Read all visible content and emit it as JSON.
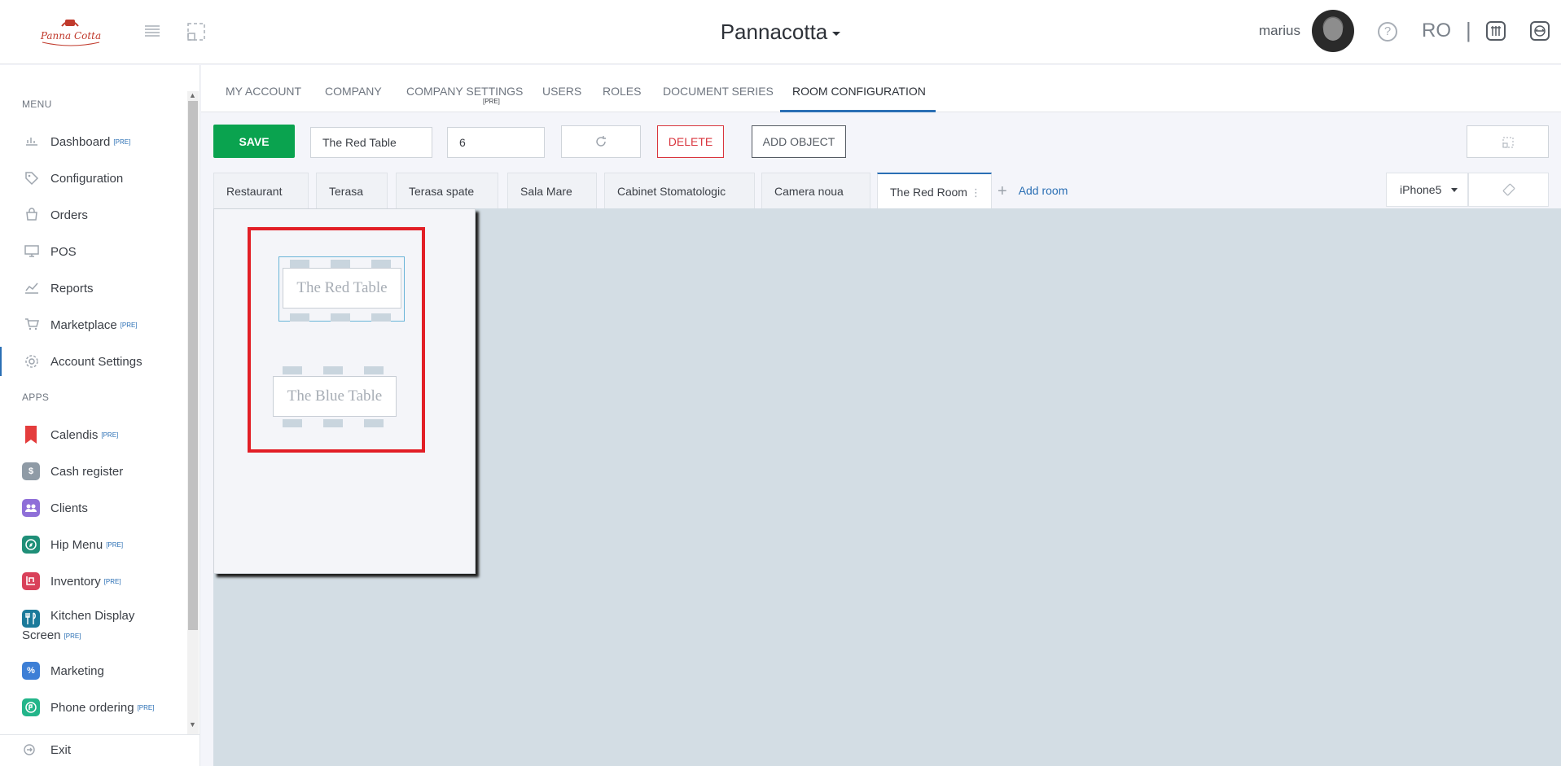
{
  "header": {
    "app_title": "Pannacotta",
    "user_name": "marius",
    "language": "RO",
    "separator": "|",
    "help_symbol": "?",
    "icons": [
      "menu-icon",
      "expand-icon",
      "help-icon",
      "grid-icon",
      "exit-fullscreen-icon"
    ]
  },
  "sidebar": {
    "menu_label": "MENU",
    "apps_label": "APPS",
    "pre_tag": "[PRE]",
    "menu_items": [
      {
        "label": "Dashboard",
        "pre": true,
        "icon": "chart-icon"
      },
      {
        "label": "Configuration",
        "pre": false,
        "icon": "tag-icon"
      },
      {
        "label": "Orders",
        "pre": false,
        "icon": "bag-icon"
      },
      {
        "label": "POS",
        "pre": false,
        "icon": "monitor-icon"
      },
      {
        "label": "Reports",
        "pre": false,
        "icon": "reports-icon"
      },
      {
        "label": "Marketplace",
        "pre": true,
        "icon": "cart-icon"
      },
      {
        "label": "Account Settings",
        "pre": false,
        "icon": "gear-icon"
      }
    ],
    "apps": [
      {
        "label": "Calendis",
        "pre": true,
        "color": "#e43c3c",
        "icon": "bookmark-icon"
      },
      {
        "label": "Cash register",
        "pre": false,
        "color": "#8f9ba6",
        "icon": "cash-register-icon"
      },
      {
        "label": "Clients",
        "pre": false,
        "color": "#8f6fd8",
        "icon": "clients-icon"
      },
      {
        "label": "Hip Menu",
        "pre": true,
        "color": "#1f8f78",
        "icon": "compass-icon"
      },
      {
        "label": "Inventory",
        "pre": true,
        "color": "#d9415a",
        "icon": "inventory-icon"
      },
      {
        "label": "Kitchen Display",
        "label2": "Screen",
        "pre": true,
        "color": "#1b7a9a",
        "icon": "utensils-icon"
      },
      {
        "label": "Marketing",
        "pre": false,
        "color": "#3d7fd6",
        "icon": "marketing-icon"
      },
      {
        "label": "Phone ordering",
        "pre": true,
        "color": "#23b58a",
        "icon": "phone-icon"
      }
    ],
    "exit_label": "Exit"
  },
  "top_tabs": {
    "items": [
      "MY ACCOUNT",
      "COMPANY",
      "COMPANY SETTINGS",
      "USERS",
      "ROLES",
      "DOCUMENT SERIES",
      "ROOM CONFIGURATION"
    ],
    "active": "ROOM CONFIGURATION",
    "pre_tag": "[PRE]"
  },
  "toolbar": {
    "save_label": "SAVE",
    "table_name": "The Red Table",
    "seats": "6",
    "delete_label": "DELETE",
    "add_object_label": "ADD OBJECT"
  },
  "rooms": {
    "tabs": [
      "Restaurant",
      "Terasa",
      "Terasa spate",
      "Sala Mare",
      "Cabinet Stomatologic",
      "Camera noua",
      "The Red Room"
    ],
    "active": "The Red Room",
    "add_room_label": "Add room",
    "device": "iPhone5"
  },
  "canvas": {
    "tables": [
      {
        "name": "The Red Table",
        "selected": true
      },
      {
        "name": "The Blue Table",
        "selected": false
      }
    ],
    "accent_selection_color": "#e21e26"
  }
}
